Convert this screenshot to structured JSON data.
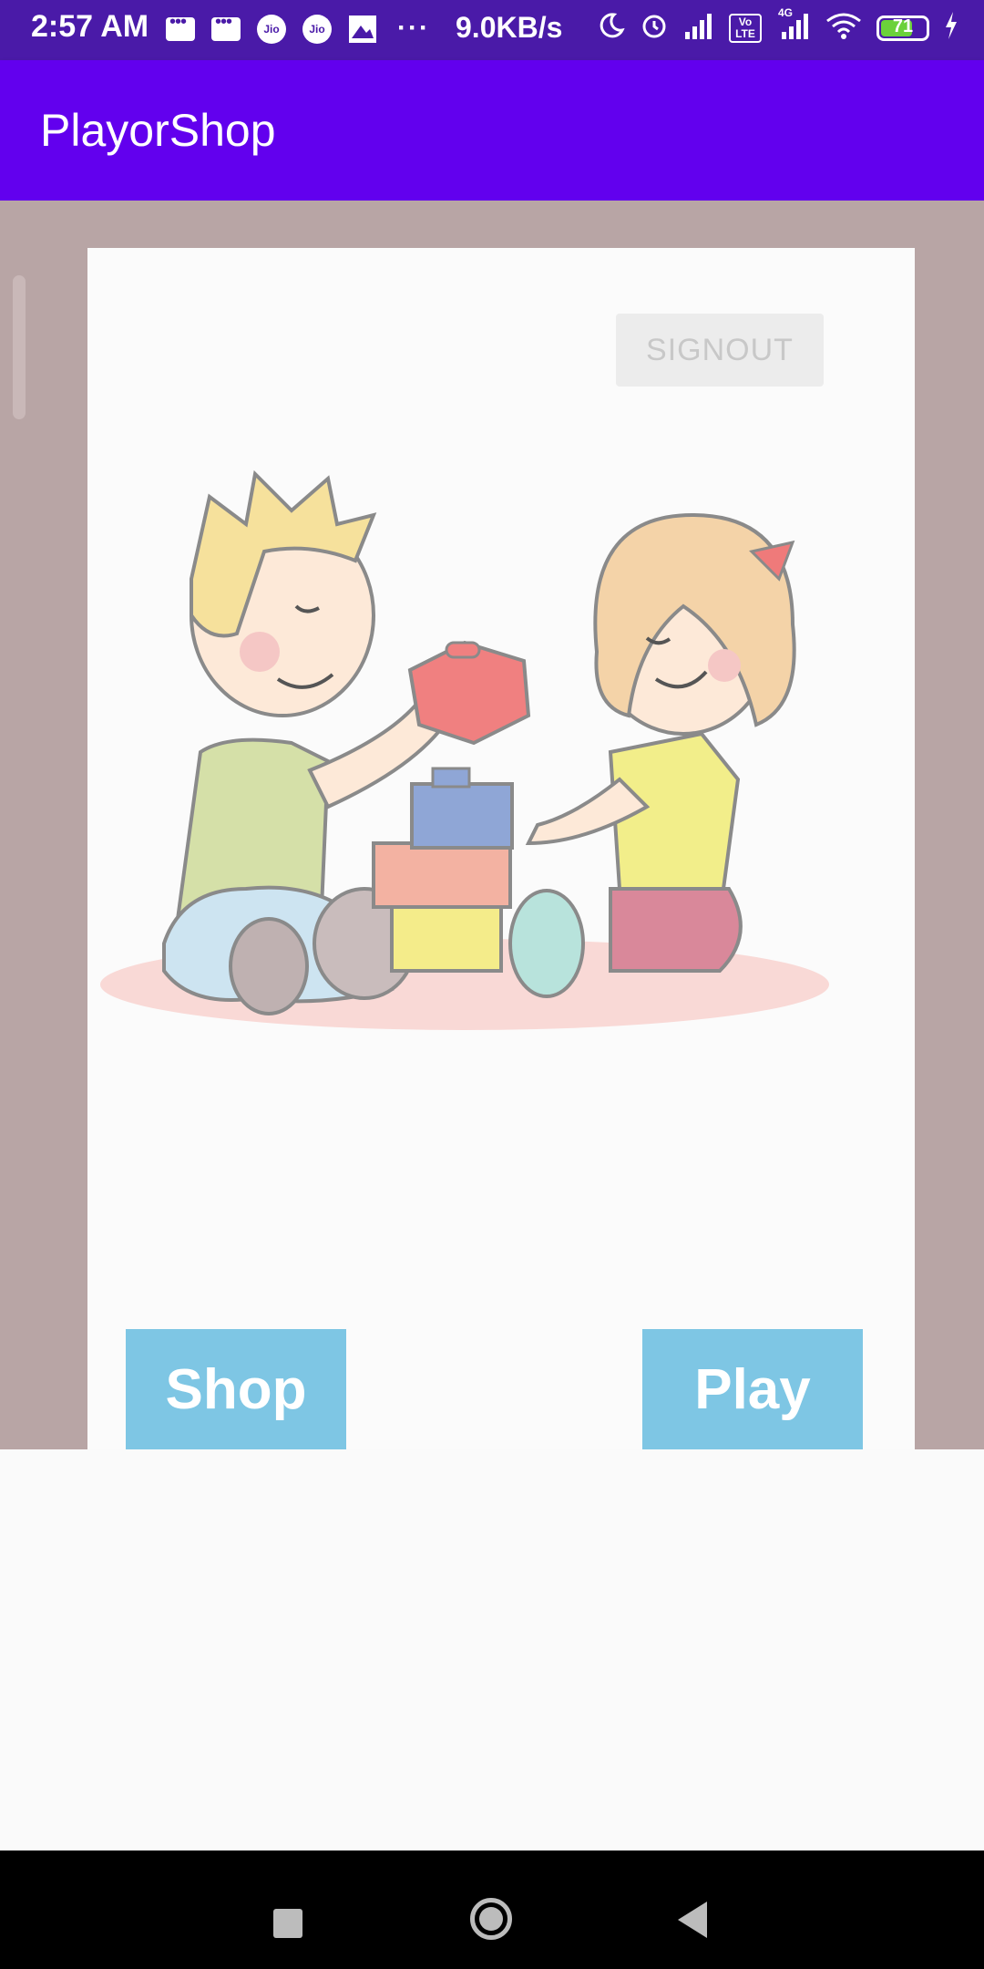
{
  "status_bar": {
    "time": "2:57 AM",
    "network_speed": "9.0KB/s",
    "battery_level": "71",
    "battery_fraction": 0.71,
    "volte_label": "Vo LTE",
    "network_type": "4G",
    "jio_label": "Jio",
    "icons": [
      "message-icon",
      "message-icon",
      "jio-icon",
      "jio-icon",
      "photo-icon",
      "more-dots-icon",
      "moon-icon",
      "alarm-icon",
      "signal-icon",
      "volte-icon",
      "signal-4g-icon",
      "wifi-icon",
      "battery-icon",
      "charging-icon"
    ]
  },
  "app_bar": {
    "title": "PlayorShop",
    "color": "#6200ee"
  },
  "main": {
    "signout_label": "SIGNOUT",
    "illustration_name": "kids-playing-blocks-illustration",
    "shop_label": "Shop",
    "play_label": "Play",
    "button_color": "#7ec6e4"
  },
  "nav_bar": {
    "icons": [
      "recents-icon",
      "home-icon",
      "back-icon"
    ]
  }
}
